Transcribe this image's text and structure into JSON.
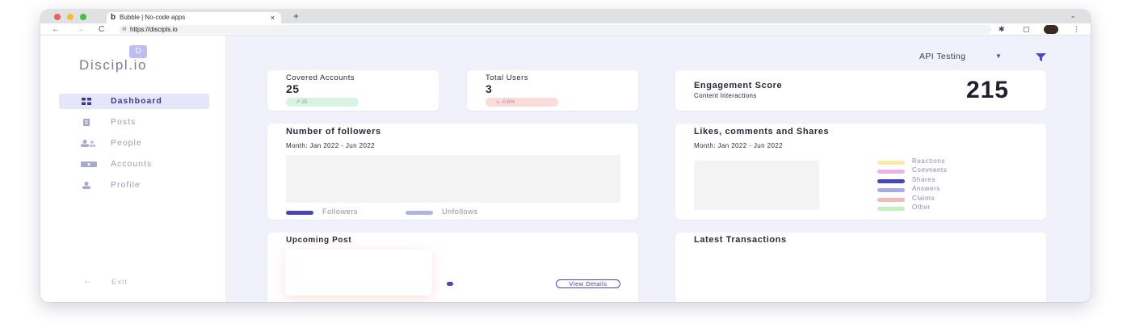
{
  "browser": {
    "tab_title": "Bubble | No-code apps",
    "tab_favicon": "b",
    "tab_close": "×",
    "new_tab": "+",
    "tab_menu": "⌄",
    "url": "https://discipls.io",
    "nav_back": "←",
    "nav_forward": "→",
    "nav_reload": "C",
    "extensions": "✱",
    "sidebar_toggle": "▢",
    "menu_dots": "⋮"
  },
  "app": {
    "logo_letter": "D",
    "logo_text": "Discipl.io"
  },
  "sidebar": {
    "items": [
      {
        "label": "Dashboard",
        "icon": "grid-icon",
        "active": true
      },
      {
        "label": "Posts",
        "icon": "posts-icon"
      },
      {
        "label": "People",
        "icon": "people-icon"
      },
      {
        "label": "Accounts",
        "icon": "accounts-icon"
      },
      {
        "label": "Profile",
        "icon": "profile-icon"
      }
    ],
    "exit_label": "Exit",
    "exit_arrow": "←"
  },
  "header": {
    "filter_value": "API Testing",
    "filter_caret": "▼"
  },
  "kpis": {
    "covered": {
      "label": "Covered Accounts",
      "value": "25",
      "badge": "↗ 25"
    },
    "users": {
      "label": "Total Users",
      "value": "3",
      "badge": "↘ -0.6%"
    }
  },
  "engagement": {
    "title": "Engagement Score",
    "subtitle": "Content Interactions",
    "value": "215"
  },
  "followers": {
    "title": "Number of followers",
    "subtitle": "Month: Jan 2022 - Jun 2022",
    "legend": [
      {
        "label": "Followers",
        "color": "#4845b6"
      },
      {
        "label": "Unfollows",
        "color": "#b1b3e4"
      }
    ]
  },
  "likes": {
    "title": "Likes, comments and Shares",
    "subtitle": "Month: Jan 2022 - Jun 2022",
    "legend": [
      {
        "label": "Reactions",
        "color": "#f7ecaa"
      },
      {
        "label": "Comments",
        "color": "#e7b3e8"
      },
      {
        "label": "Shares",
        "color": "#4845b6"
      },
      {
        "label": "Answers",
        "color": "#a9abe3"
      },
      {
        "label": "Claims",
        "color": "#f1b9b9"
      },
      {
        "label": "Other",
        "color": "#c2f0c4"
      }
    ]
  },
  "upcoming": {
    "title": "Upcoming Post",
    "button": "View Details"
  },
  "transactions": {
    "title": "Latest Transactions"
  },
  "colors": {
    "accent": "#4845b6",
    "background": "#f1f1fb"
  }
}
